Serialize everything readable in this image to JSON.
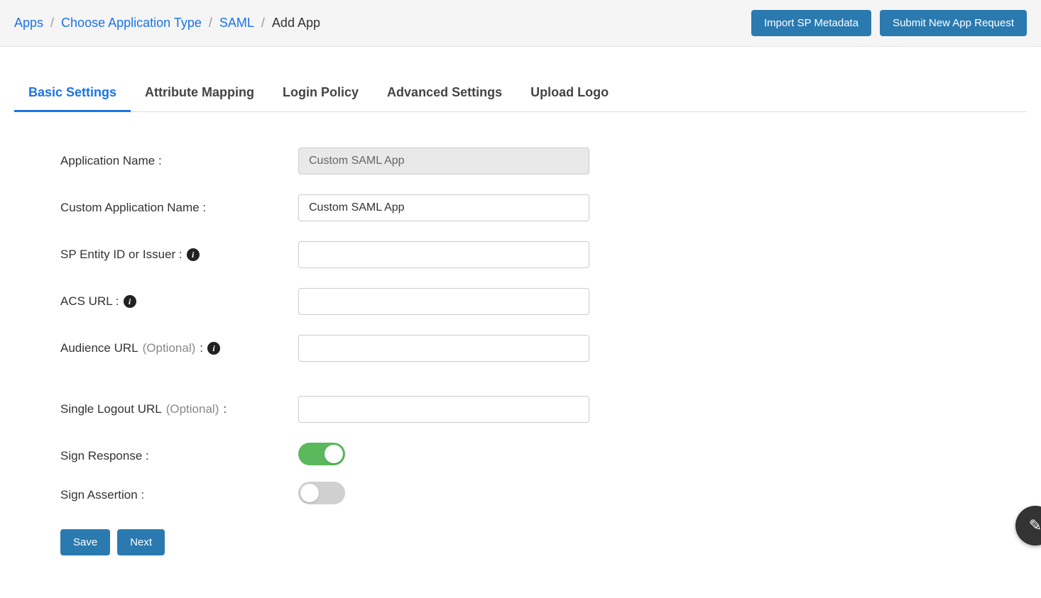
{
  "breadcrumb": {
    "apps": "Apps",
    "choose": "Choose Application Type",
    "saml": "SAML",
    "current": "Add App"
  },
  "header_buttons": {
    "import": "Import SP Metadata",
    "submit": "Submit New App Request"
  },
  "tabs": [
    {
      "label": "Basic Settings",
      "active": true
    },
    {
      "label": "Attribute Mapping",
      "active": false
    },
    {
      "label": "Login Policy",
      "active": false
    },
    {
      "label": "Advanced Settings",
      "active": false
    },
    {
      "label": "Upload Logo",
      "active": false
    }
  ],
  "form": {
    "app_name_label": "Application Name :",
    "app_name_value": "Custom SAML App",
    "custom_app_name_label": "Custom Application Name :",
    "custom_app_name_value": "Custom SAML App",
    "sp_entity_label": "SP Entity ID or Issuer :",
    "sp_entity_value": "",
    "acs_url_label": "ACS URL :",
    "acs_url_value": "",
    "audience_url_label": "Audience URL",
    "audience_url_optional": "(Optional)",
    "audience_url_colon": " :",
    "audience_url_value": "",
    "single_logout_label": "Single Logout URL",
    "single_logout_optional": "(Optional)",
    "single_logout_colon": " :",
    "single_logout_value": "",
    "sign_response_label": "Sign Response :",
    "sign_response_on": true,
    "sign_assertion_label": "Sign Assertion :",
    "sign_assertion_on": false
  },
  "actions": {
    "save": "Save",
    "next": "Next"
  }
}
